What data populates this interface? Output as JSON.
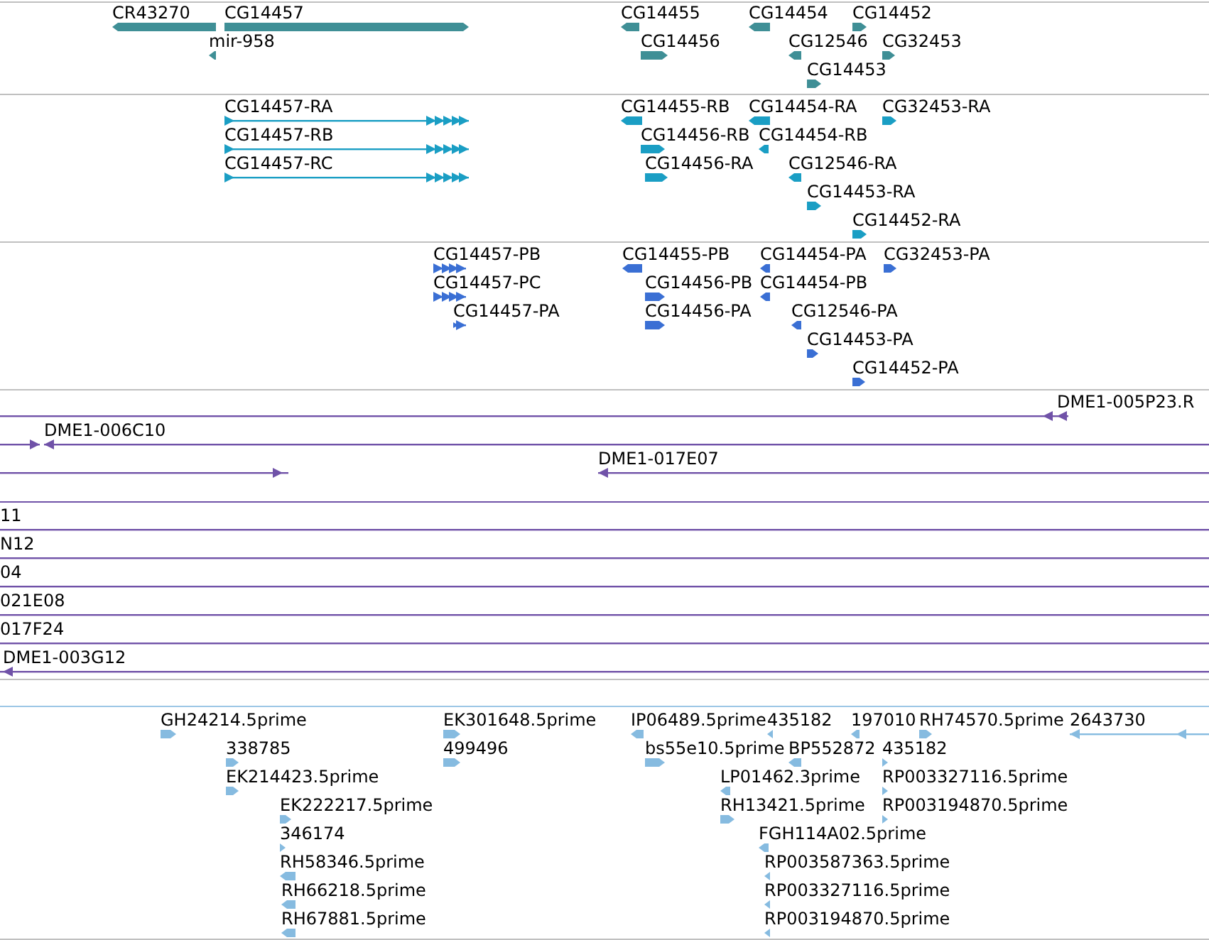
{
  "tracks": [
    {
      "kind": "gene",
      "color": "#3f8f96",
      "features": [
        {
          "label": "CR43270",
          "reverse": true
        },
        {
          "label": "CG14457",
          "reverse": false
        },
        {
          "label": "CG14455",
          "reverse": true
        },
        {
          "label": "CG14454",
          "reverse": true
        },
        {
          "label": "CG14452",
          "reverse": false
        },
        {
          "label": "mir-958",
          "reverse": true
        },
        {
          "label": "CG14456",
          "reverse": false
        },
        {
          "label": "CG12546",
          "reverse": true
        },
        {
          "label": "CG32453",
          "reverse": false
        },
        {
          "label": "CG14453",
          "reverse": false
        }
      ]
    },
    {
      "kind": "transcript",
      "color": "#1a9ec4",
      "features": [
        {
          "label": "CG14457-RA",
          "reverse": false
        },
        {
          "label": "CG14455-RB",
          "reverse": true
        },
        {
          "label": "CG14454-RA",
          "reverse": true
        },
        {
          "label": "CG32453-RA",
          "reverse": false
        },
        {
          "label": "CG14457-RB",
          "reverse": false
        },
        {
          "label": "CG14456-RB",
          "reverse": false
        },
        {
          "label": "CG14454-RB",
          "reverse": true
        },
        {
          "label": "CG14457-RC",
          "reverse": false
        },
        {
          "label": "CG14456-RA",
          "reverse": false
        },
        {
          "label": "CG12546-RA",
          "reverse": true
        },
        {
          "label": "CG14453-RA",
          "reverse": false
        },
        {
          "label": "CG14452-RA",
          "reverse": false
        }
      ]
    },
    {
      "kind": "protein",
      "color": "#3a6fd4",
      "features": [
        {
          "label": "CG14457-PB",
          "reverse": false
        },
        {
          "label": "CG14455-PB",
          "reverse": true
        },
        {
          "label": "CG14454-PA",
          "reverse": true
        },
        {
          "label": "CG32453-PA",
          "reverse": false
        },
        {
          "label": "CG14457-PC",
          "reverse": false
        },
        {
          "label": "CG14456-PB",
          "reverse": false
        },
        {
          "label": "CG14454-PB",
          "reverse": true
        },
        {
          "label": "CG14457-PA",
          "reverse": false
        },
        {
          "label": "CG14456-PA",
          "reverse": false
        },
        {
          "label": "CG12546-PA",
          "reverse": true
        },
        {
          "label": "CG14453-PA",
          "reverse": false
        },
        {
          "label": "CG14452-PA",
          "reverse": false
        }
      ]
    },
    {
      "kind": "bac",
      "color": "#7052a8",
      "features": [
        {
          "label": "DME1-005P23.R",
          "reverse": true
        },
        {
          "reverse": false
        },
        {
          "label": "DME1-006C10",
          "reverse": true
        },
        {
          "reverse": false
        },
        {
          "label": "DME1-017E07",
          "reverse": true
        },
        {
          "label": "11"
        },
        {
          "label": "N12"
        },
        {
          "label": "04"
        },
        {
          "label": "021E08"
        },
        {
          "label": "017F24"
        },
        {
          "label": "DME1-003G12",
          "reverse": true
        }
      ]
    },
    {
      "kind": "est",
      "color": "#86bbe0",
      "features": [
        {
          "label": "GH24214.5prime",
          "reverse": false
        },
        {
          "label": "EK301648.5prime",
          "reverse": false
        },
        {
          "label": "IP06489.5prime",
          "reverse": true
        },
        {
          "label": "435182",
          "reverse": true
        },
        {
          "label": "197010",
          "reverse": true
        },
        {
          "label": "RH74570.5prime",
          "reverse": false
        },
        {
          "label": "2643730",
          "reverse": true
        },
        {
          "label": "338785",
          "reverse": false
        },
        {
          "label": "499496",
          "reverse": false
        },
        {
          "label": "bs55e10.5prime",
          "reverse": false
        },
        {
          "label": "BP552872",
          "reverse": true
        },
        {
          "label": "435182",
          "reverse": false
        },
        {
          "label": "EK214423.5prime",
          "reverse": false
        },
        {
          "label": "LP01462.3prime",
          "reverse": true
        },
        {
          "label": "RP003327116.5prime",
          "reverse": false
        },
        {
          "label": "EK222217.5prime",
          "reverse": false
        },
        {
          "label": "RH13421.5prime",
          "reverse": false
        },
        {
          "label": "RP003194870.5prime",
          "reverse": false
        },
        {
          "label": "346174",
          "reverse": false
        },
        {
          "label": "FGH114A02.5prime",
          "reverse": true
        },
        {
          "label": "RH58346.5prime",
          "reverse": true
        },
        {
          "label": "RP003587363.5prime",
          "reverse": true
        },
        {
          "label": "RH66218.5prime",
          "reverse": true
        },
        {
          "label": "RP003327116.5prime",
          "reverse": true
        },
        {
          "label": "RH67881.5prime",
          "reverse": true
        },
        {
          "label": "RP003194870.5prime",
          "reverse": true
        }
      ]
    }
  ]
}
